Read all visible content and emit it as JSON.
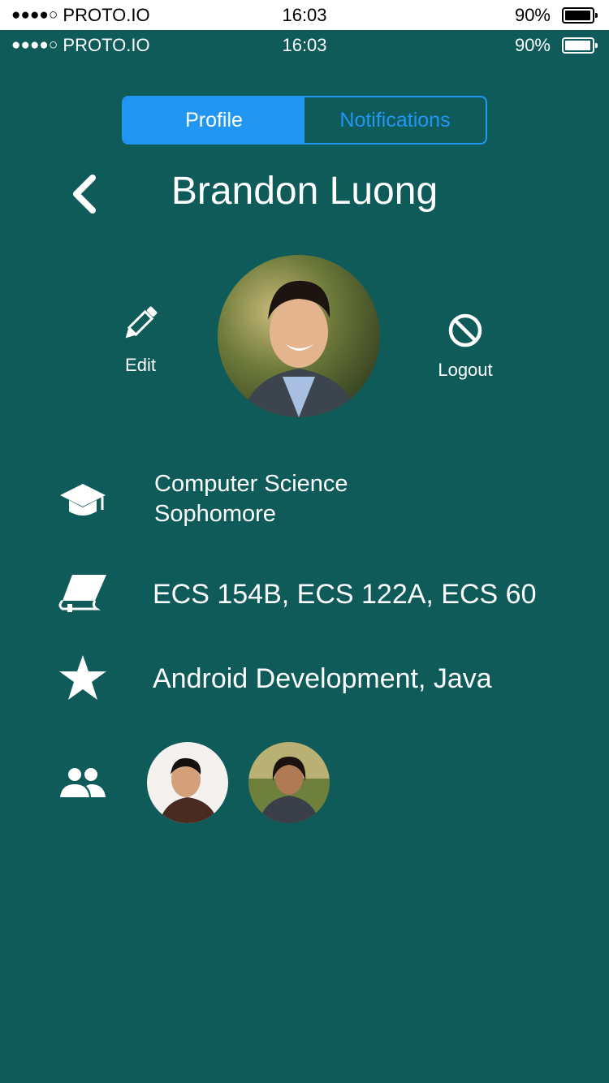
{
  "status_bar": {
    "signal_dots": "●●●●○",
    "carrier": "PROTO.IO",
    "time": "16:03",
    "battery": "90%"
  },
  "tabs": [
    {
      "label": "Profile",
      "active": true
    },
    {
      "label": "Notifications",
      "active": false
    }
  ],
  "profile": {
    "name": "Brandon Luong",
    "edit_label": "Edit",
    "logout_label": "Logout"
  },
  "info": {
    "major": "Computer Science",
    "year": "Sophomore",
    "courses": "ECS 154B, ECS 122A, ECS 60",
    "skills": "Android Development, Java"
  },
  "icons": {
    "back": "chevron-left-icon",
    "edit": "pencil-icon",
    "logout": "ban-icon",
    "education": "graduation-cap-icon",
    "courses": "book-icon",
    "skills": "star-icon",
    "friends": "group-icon"
  },
  "colors": {
    "background": "#0e5b5a",
    "accent": "#2196f3",
    "text": "#ffffff"
  }
}
